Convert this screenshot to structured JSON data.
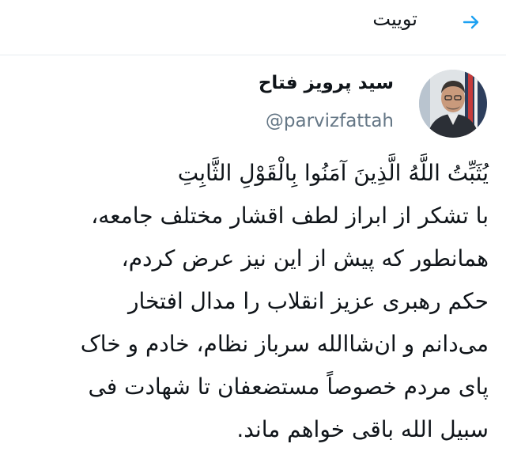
{
  "header": {
    "title": "توییت",
    "back_icon": "arrow-right-icon",
    "accent_color": "#1da1f2"
  },
  "author": {
    "name": "سید پرویز فتاح",
    "handle": "@parvizfattah",
    "avatar_icon": "user-avatar"
  },
  "tweet": {
    "lines": [
      "يُثَبِّتُ اللَّهُ الَّذِينَ آمَنُوا بِالْقَوْلِ الثَّابِتِ",
      "با تشکر از ابراز لطف اقشار مختلف جامعه،",
      "همانطور که پیش از این نیز عرض کردم،",
      "حکم رهبری عزیز انقلاب را مدال افتخار",
      "می‌دانم و ان‌شاالله سرباز نظام، خادم و خاک",
      "پای مردم خصوصاً مستضعفان تا شهادت فی",
      "سبیل الله باقی خواهم ماند."
    ]
  }
}
